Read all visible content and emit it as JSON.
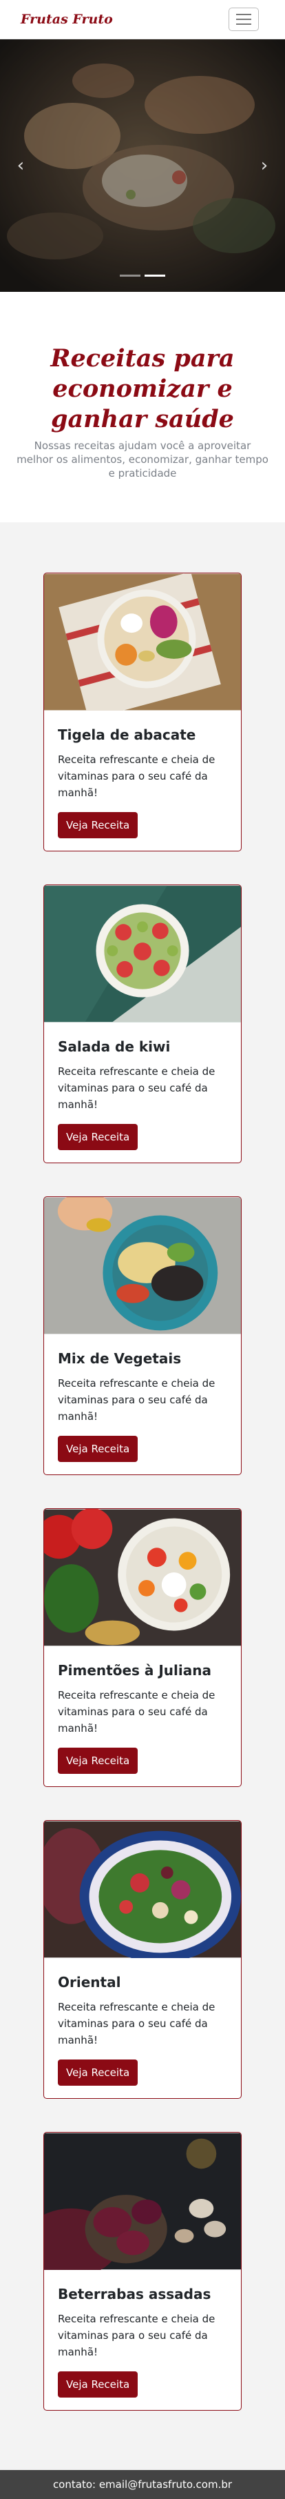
{
  "navbar": {
    "brand": "Frutas Fruto",
    "menu_icon": "hamburger-icon"
  },
  "carousel": {
    "prev_icon": "chevron-left-icon",
    "next_icon": "chevron-right-icon",
    "prev_glyph": "‹",
    "next_glyph": "›",
    "slide_count": 2,
    "active_slide": 2
  },
  "hero": {
    "title": "Receitas para economizar e ganhar saúde",
    "subtitle": "Nossas receitas ajudam você a aproveitar melhor os alimentos, economizar, ganhar tempo e praticidade"
  },
  "recipes": [
    {
      "title": "Tigela de abacate",
      "text": "Receita refrescante e cheia de vitaminas para o seu café da manhã!",
      "button": "Veja Receita"
    },
    {
      "title": "Salada de kiwi",
      "text": "Receita refrescante e cheia de vitaminas para o seu café da manhã!",
      "button": "Veja Receita"
    },
    {
      "title": "Mix de Vegetais",
      "text": "Receita refrescante e cheia de vitaminas para o seu café da manhã!",
      "button": "Veja Receita"
    },
    {
      "title": "Pimentões à Juliana",
      "text": "Receita refrescante e cheia de vitaminas para o seu café da manhã!",
      "button": "Veja Receita"
    },
    {
      "title": "Oriental",
      "text": "Receita refrescante e cheia de vitaminas para o seu café da manhã!",
      "button": "Veja Receita"
    },
    {
      "title": "Beterrabas assadas",
      "text": "Receita refrescante e cheia de vitaminas para o seu café da manhã!",
      "button": "Veja Receita"
    }
  ],
  "footer": {
    "contact": "contato: email@frutasfruto.com.br"
  },
  "colors": {
    "brand": "#8b0a14",
    "footer_bg": "#434343",
    "section_bg": "#f3f3f3"
  }
}
